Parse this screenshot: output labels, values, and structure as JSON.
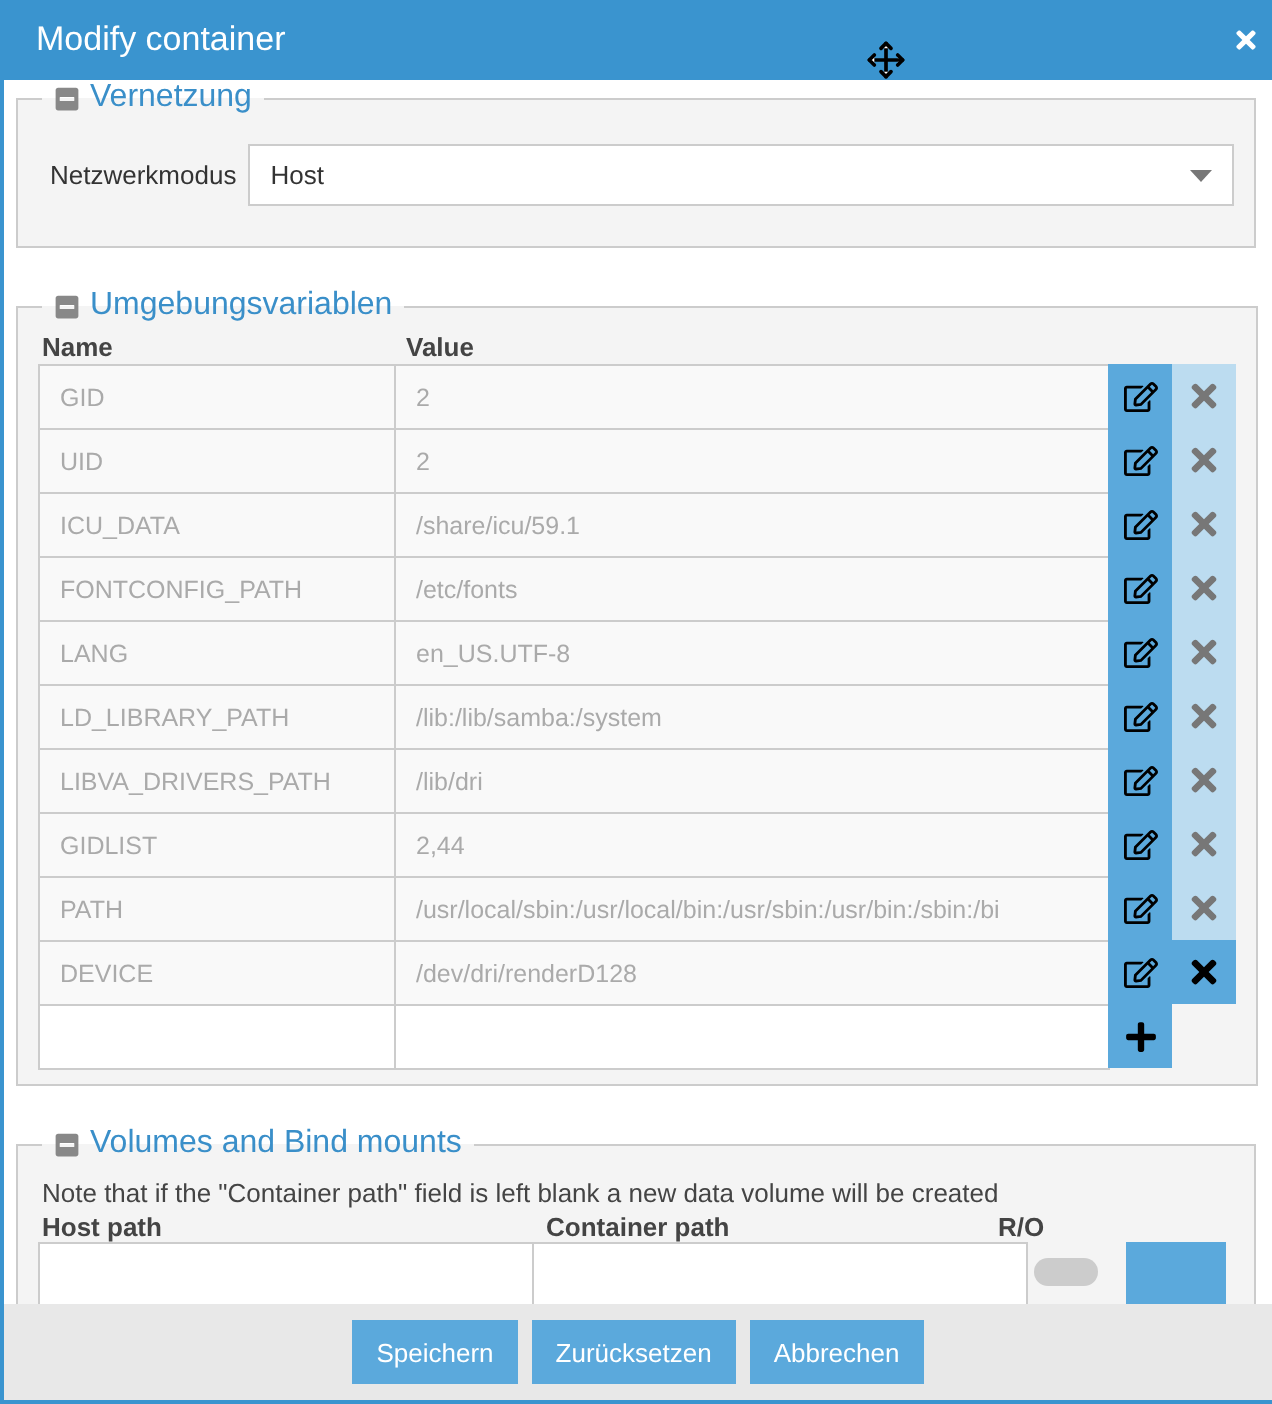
{
  "window": {
    "title": "Modify container"
  },
  "network": {
    "legend": "Vernetzung",
    "expanded": true,
    "label": "Netzwerkmodus",
    "value": "Host"
  },
  "environment": {
    "legend": "Umgebungsvariablen",
    "expanded": true,
    "columns": [
      "Name",
      "Value"
    ],
    "rows": [
      {
        "name": "GID",
        "value": "2",
        "highlighted": false
      },
      {
        "name": "UID",
        "value": "2",
        "highlighted": false
      },
      {
        "name": "ICU_DATA",
        "value": "/share/icu/59.1",
        "highlighted": false
      },
      {
        "name": "FONTCONFIG_PATH",
        "value": "/etc/fonts",
        "highlighted": false
      },
      {
        "name": "LANG",
        "value": "en_US.UTF-8",
        "highlighted": false
      },
      {
        "name": "LD_LIBRARY_PATH",
        "value": "/lib:/lib/samba:/system",
        "highlighted": false
      },
      {
        "name": "LIBVA_DRIVERS_PATH",
        "value": "/lib/dri",
        "highlighted": false
      },
      {
        "name": "GIDLIST",
        "value": "2,44",
        "highlighted": false
      },
      {
        "name": "PATH",
        "value": "/usr/local/sbin:/usr/local/bin:/usr/sbin:/usr/bin:/sbin:/bi",
        "highlighted": false
      },
      {
        "name": "DEVICE",
        "value": "/dev/dri/renderD128",
        "highlighted": true
      }
    ]
  },
  "volumes": {
    "legend": "Volumes and Bind mounts",
    "expanded": true,
    "note": "Note that if the \"Container path\" field is left blank a new data volume will be created",
    "columns": [
      "Host path",
      "Container path",
      "R/O"
    ],
    "read_only": false
  },
  "buttons": [
    "Speichern",
    "Zurücksetzen",
    "Abbrechen"
  ]
}
